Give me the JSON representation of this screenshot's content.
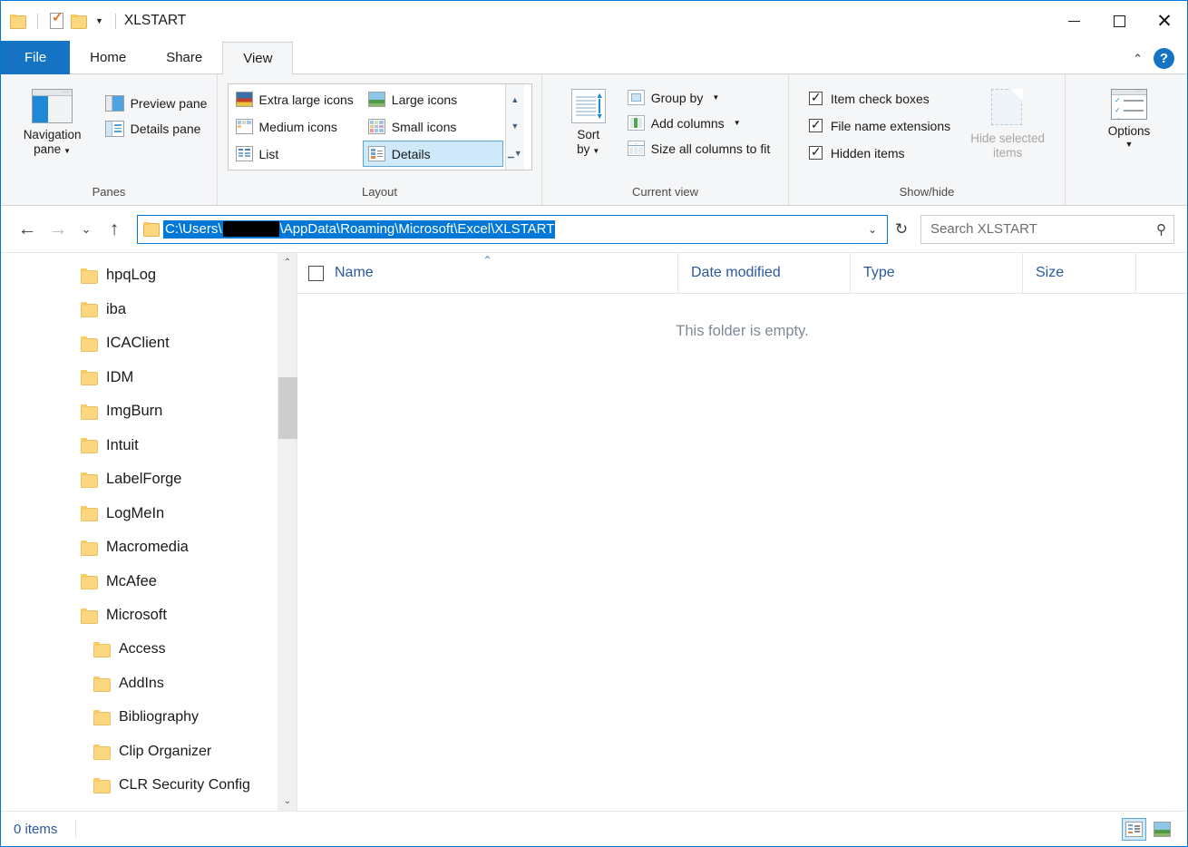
{
  "window": {
    "title": "XLSTART",
    "quick_access": [
      "folder-icon",
      "properties-icon",
      "new-folder-icon"
    ],
    "buttons": {
      "minimize": "minimize",
      "maximize": "maximize",
      "close": "close"
    }
  },
  "ribbon": {
    "tabs": [
      {
        "label": "File",
        "active": false,
        "style": "file"
      },
      {
        "label": "Home",
        "active": false
      },
      {
        "label": "Share",
        "active": false
      },
      {
        "label": "View",
        "active": true
      }
    ],
    "collapse_label": "^",
    "help_label": "?",
    "groups": {
      "panes": {
        "label": "Panes",
        "navigation_pane": "Navigation\npane",
        "navigation_pane_line1": "Navigation",
        "navigation_pane_line2": "pane",
        "preview_pane": "Preview pane",
        "details_pane": "Details pane"
      },
      "layout": {
        "label": "Layout",
        "items": [
          {
            "label": "Extra large icons",
            "selected": false
          },
          {
            "label": "Large icons",
            "selected": false
          },
          {
            "label": "Medium icons",
            "selected": false
          },
          {
            "label": "Small icons",
            "selected": false
          },
          {
            "label": "List",
            "selected": false
          },
          {
            "label": "Details",
            "selected": true
          }
        ]
      },
      "current_view": {
        "label": "Current view",
        "sort_by_line1": "Sort",
        "sort_by_line2": "by",
        "group_by": "Group by",
        "add_columns": "Add columns",
        "size_all_columns": "Size all columns to fit"
      },
      "show_hide": {
        "label": "Show/hide",
        "checkboxes": [
          {
            "label": "Item check boxes",
            "checked": true
          },
          {
            "label": "File name extensions",
            "checked": true
          },
          {
            "label": "Hidden items",
            "checked": true
          }
        ],
        "hide_selected_line1": "Hide selected",
        "hide_selected_line2": "items",
        "hide_selected_enabled": false,
        "options": "Options"
      }
    }
  },
  "address_bar": {
    "back": "←",
    "forward": "→",
    "recent": "⌄",
    "up": "↑",
    "path_prefix": "C:\\Users\\",
    "path_suffix": "\\AppData\\Roaming\\Microsoft\\Excel\\XLSTART",
    "path_redacted": true,
    "full_path": "C:\\Users\\[redacted]\\AppData\\Roaming\\Microsoft\\Excel\\XLSTART",
    "selected": true,
    "dropdown": "⌄",
    "refresh": "↻",
    "search_placeholder": "Search XLSTART",
    "search_value": ""
  },
  "navigation_tree": {
    "items": [
      {
        "label": "hpqLog",
        "level": 0
      },
      {
        "label": "iba",
        "level": 0
      },
      {
        "label": "ICAClient",
        "level": 0
      },
      {
        "label": "IDM",
        "level": 0
      },
      {
        "label": "ImgBurn",
        "level": 0
      },
      {
        "label": "Intuit",
        "level": 0
      },
      {
        "label": "LabelForge",
        "level": 0
      },
      {
        "label": "LogMeIn",
        "level": 0
      },
      {
        "label": "Macromedia",
        "level": 0
      },
      {
        "label": "McAfee",
        "level": 0
      },
      {
        "label": "Microsoft",
        "level": 0
      },
      {
        "label": "Access",
        "level": 1
      },
      {
        "label": "AddIns",
        "level": 1
      },
      {
        "label": "Bibliography",
        "level": 1
      },
      {
        "label": "Clip Organizer",
        "level": 1
      },
      {
        "label": "CLR Security Config",
        "level": 1
      }
    ],
    "scroll_up": "⌃",
    "scroll_down": "⌄"
  },
  "file_list": {
    "columns": [
      {
        "label": "Name",
        "sorted": "asc",
        "sort_glyph": "⌃"
      },
      {
        "label": "Date modified",
        "sorted": ""
      },
      {
        "label": "Type",
        "sorted": ""
      },
      {
        "label": "Size",
        "sorted": ""
      }
    ],
    "empty_message": "This folder is empty.",
    "rows": []
  },
  "status_bar": {
    "item_count": "0 items",
    "view_details": "details-view",
    "view_large_icons": "large-icons-view"
  },
  "colors": {
    "accent": "#0078d7",
    "file_tab": "#1573c4",
    "folder_yellow": "#fcd77f",
    "selection": "#cfe8fa",
    "header_text": "#2a5a9b"
  }
}
